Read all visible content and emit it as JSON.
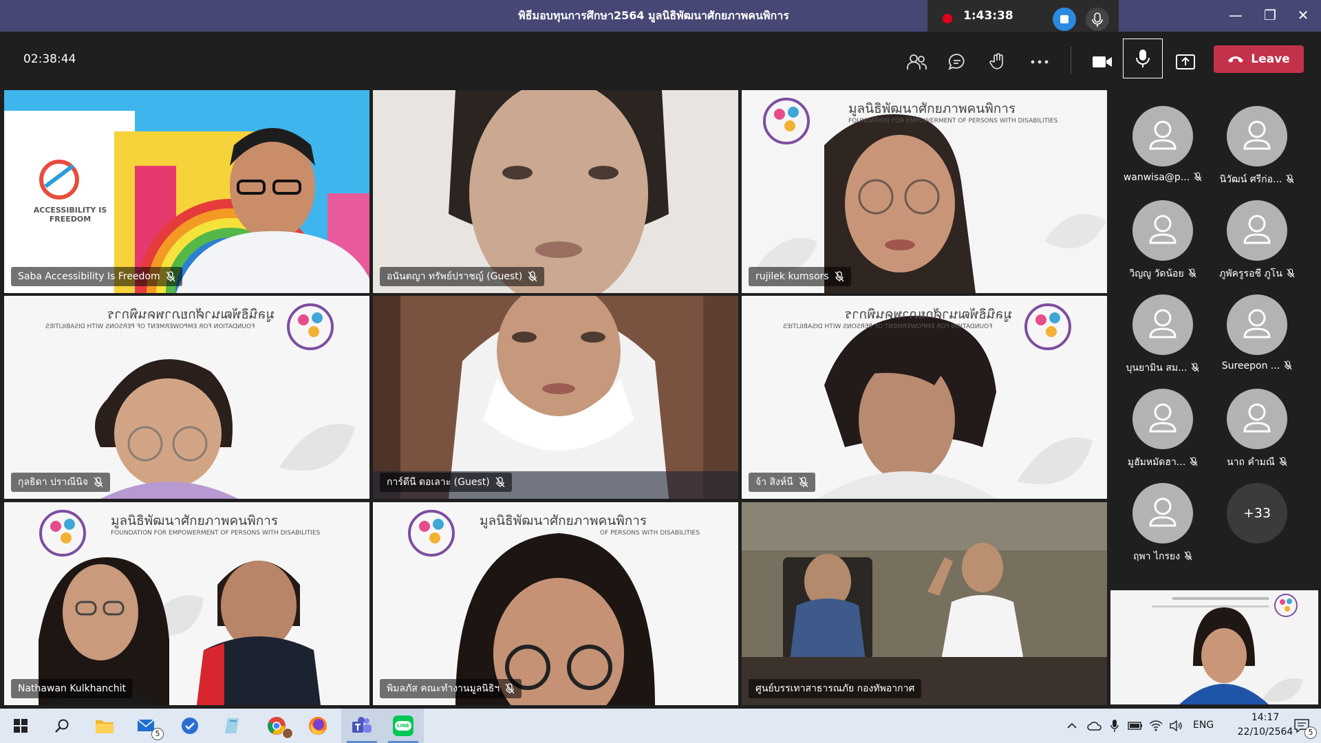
{
  "window": {
    "title": "พิธีมอบทุนการศึกษา2564 มูลนิธิพัฒนาศักยภาพคนพิการ",
    "recording_time": "1:43:38"
  },
  "toolbar": {
    "meeting_timer": "02:38:44",
    "leave_label": "Leave"
  },
  "tiles": [
    {
      "name": "Saba Accessibility Is Freedom",
      "muted": true,
      "caption": "ACCESSIBILITY IS FREEDOM"
    },
    {
      "name": "อนันตญา ทรัพย์ปราชญ์ (Guest)",
      "muted": true
    },
    {
      "name": "rujilek kumsors",
      "muted": true,
      "banner_th": "มูลนิธิพัฒนาศักยภาพคนพิการ",
      "banner_en": "FOUNDATION FOR EMPOWERMENT OF PERSONS WITH DISABILITIES"
    },
    {
      "name": "กุลธิดา ปราณีนิจ",
      "muted": true,
      "banner_th": "มูลนิธิพัฒนาศักยภาพคนพิการ",
      "banner_en": "FOUNDATION FOR EMPOWERMENT OF PERSONS WITH DISABILITIES"
    },
    {
      "name": "การ์ดีนี ดอเลาะ (Guest)",
      "muted": true
    },
    {
      "name": "จ้า สิงห์นี",
      "muted": true,
      "banner_th": "มูลนิธิพัฒนาศักยภาพคนพิการ",
      "banner_en": "FOUNDATION FOR EMPOWERMENT OF PERSONS WITH DISABILITIES"
    },
    {
      "name": "Nathawan Kulkhanchit",
      "muted": false,
      "banner_th": "มูลนิธิพัฒนาศักยภาพคนพิการ",
      "banner_en": "FOUNDATION FOR EMPOWERMENT OF PERSONS WITH DISABILITIES"
    },
    {
      "name": "พิมลภัส คณะทำงานมูลนิธิฯ",
      "muted": true,
      "banner_th": "มูลนิธิพัฒนาศักยภาพคนพิการ",
      "banner_en": "OF PERSONS WITH DISABILITIES"
    },
    {
      "name": "ศูนย์บรรเทาสาธารณภัย กองทัพอากาศ",
      "muted": false
    }
  ],
  "roster": [
    {
      "name": "wanwisa@p...",
      "muted": true
    },
    {
      "name": "นิวัฒน์ ศรีก่อ...",
      "muted": true
    },
    {
      "name": "วิญญู วัดน้อย",
      "muted": true
    },
    {
      "name": "ภูพัครูรอชี ภูโน",
      "muted": true
    },
    {
      "name": "บุนยามิน สม...",
      "muted": true
    },
    {
      "name": "Sureepon ...",
      "muted": true
    },
    {
      "name": "มูฮัมหมัดฮา...",
      "muted": true
    },
    {
      "name": "นาถ คำมณี",
      "muted": true
    },
    {
      "name": "ฤพา ไกรยง",
      "muted": true
    }
  ],
  "roster_more": "+33",
  "taskbar": {
    "mail_badge": "5",
    "line_label": "LINE",
    "language": "ENG",
    "time": "14:17",
    "date": "22/10/2564",
    "notification_count": "5"
  },
  "colors": {
    "title_bar": "#464775",
    "leave_button": "#c4314b",
    "recording_dot": "#e3001b",
    "active_speaker_border": "#8b8cc7",
    "taskbar": "#dfe8f3"
  }
}
